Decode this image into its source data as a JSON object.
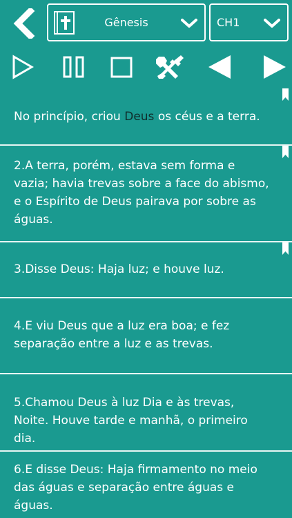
{
  "header": {
    "book": "Gênesis",
    "chapter": "CH1"
  },
  "toolbar": {
    "play": "play-icon",
    "pause": "pause-icon",
    "stop": "stop-icon",
    "settings": "tools-icon",
    "prev": "previous-icon",
    "next": "next-icon"
  },
  "verses": [
    {
      "before": "No princípio, criou ",
      "highlight": "Deus",
      "after": " os céus e a terra."
    },
    {
      "text": "2.A terra, porém, estava sem forma e vazia; havia trevas sobre a face do abismo, e o Espírito de Deus pairava por sobre as águas."
    },
    {
      "text": "3.Disse Deus: Haja luz; e houve luz."
    },
    {
      "text": "4.E viu Deus que a luz era boa; e fez separação entre a luz e as trevas."
    },
    {
      "text": "5.Chamou Deus à luz Dia e às trevas, Noite. Houve tarde e manhã, o primeiro dia."
    },
    {
      "text": "6.E disse Deus: Haja firmamento no meio das águas e separação entre águas e águas."
    }
  ],
  "colors": {
    "background": "#1a9a90",
    "text": "#ffffff",
    "highlight": "#0f2e2c"
  }
}
